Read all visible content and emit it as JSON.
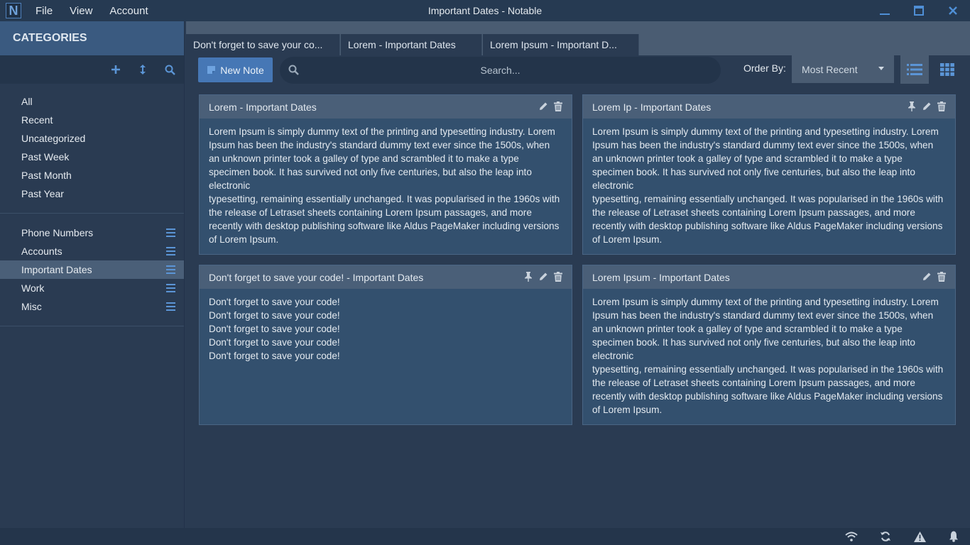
{
  "app": {
    "logo_letter": "N",
    "window_title": "Important Dates - Notable",
    "menu": [
      "File",
      "View",
      "Account"
    ]
  },
  "sidebar": {
    "header": "CATEGORIES",
    "smart_items": [
      "All",
      "Recent",
      "Uncategorized",
      "Past Week",
      "Past Month",
      "Past Year"
    ],
    "categories": [
      {
        "label": "Phone Numbers",
        "active": false
      },
      {
        "label": "Accounts",
        "active": false
      },
      {
        "label": "Important Dates",
        "active": true
      },
      {
        "label": "Work",
        "active": false
      },
      {
        "label": "Misc",
        "active": false
      }
    ]
  },
  "tabs": [
    "Don't forget to save your co...",
    "Lorem - Important Dates",
    "Lorem Ipsum - Important D..."
  ],
  "toolbar": {
    "new_note_label": "New Note",
    "search_placeholder": "Search...",
    "order_by_label": "Order By:",
    "order_by_value": "Most Recent"
  },
  "notes": [
    {
      "title": "Lorem  -  Important Dates",
      "pinned": false,
      "body": "Lorem Ipsum is simply dummy text of the printing and typesetting industry. Lorem Ipsum has been the industry's standard dummy text ever since the 1500s, when an unknown printer took a galley of type and scrambled it to make a type specimen book. It has survived not only five centuries, but also the leap into electronic\ntypesetting, remaining essentially unchanged. It was popularised in the 1960s with the release of Letraset sheets containing Lorem Ipsum passages, and more recently with desktop publishing software like Aldus PageMaker including versions of Lorem Ipsum."
    },
    {
      "title": "Lorem Ip  -  Important Dates",
      "pinned": true,
      "body": "Lorem Ipsum is simply dummy text of the printing and typesetting industry. Lorem Ipsum has been the industry's standard dummy text ever since the 1500s, when an unknown printer took a galley of type and scrambled it to make a type specimen book. It has survived not only five centuries, but also the leap into electronic\ntypesetting, remaining essentially unchanged. It was popularised in the 1960s with the release of Letraset sheets containing Lorem Ipsum passages, and more recently with desktop publishing software like Aldus PageMaker including versions of Lorem Ipsum."
    },
    {
      "title": "Don't forget to save your code!  -  Important Dates",
      "pinned": true,
      "body": "Don't forget to save your code!\nDon't forget to save your code!\nDon't forget to save your code!\nDon't forget to save your code!\nDon't forget to save your code!"
    },
    {
      "title": "Lorem Ipsum  -  Important Dates",
      "pinned": false,
      "body": "Lorem Ipsum is simply dummy text of the printing and typesetting industry. Lorem Ipsum has been the industry's standard dummy text ever since the 1500s, when an unknown printer took a galley of type and scrambled it to make a type specimen book. It has survived not only five centuries, but also the leap into electronic\ntypesetting, remaining essentially unchanged. It was popularised in the 1960s with the release of Letraset sheets containing Lorem Ipsum passages, and more recently with desktop publishing software like Aldus PageMaker including versions of Lorem Ipsum."
    }
  ],
  "status_icons": [
    "wifi-icon",
    "sync-icon",
    "warning-icon",
    "bell-icon"
  ],
  "colors": {
    "accent": "#4677b5",
    "icon_blue": "#5b95d6",
    "background": "#2a3b52",
    "card": "#33506e"
  }
}
